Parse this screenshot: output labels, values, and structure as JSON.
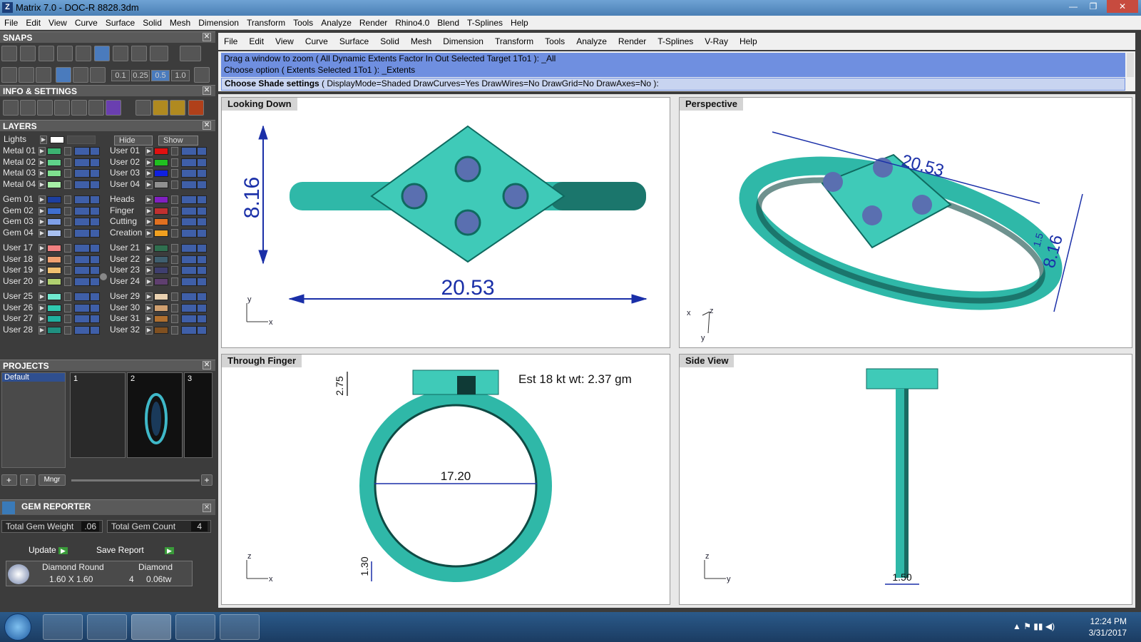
{
  "window": {
    "title": "Matrix 7.0 - DOC-R 8828.3dm",
    "icon": "Z"
  },
  "main_menu": [
    "File",
    "Edit",
    "View",
    "Curve",
    "Surface",
    "Solid",
    "Mesh",
    "Dimension",
    "Transform",
    "Tools",
    "Analyze",
    "Render",
    "Rhino4.0",
    "Blend",
    "T-Splines",
    "Help"
  ],
  "cmd_menu": [
    "File",
    "Edit",
    "View",
    "Curve",
    "Surface",
    "Solid",
    "Mesh",
    "Dimension",
    "Transform",
    "Tools",
    "Analyze",
    "Render",
    "T-Splines",
    "V-Ray",
    "Help"
  ],
  "command": {
    "line1": "Drag a window to zoom ( All  Dynamic  Extents  Factor  In  Out  Selected  Target  1To1 ): _All",
    "line2": "Choose option ( Extents  Selected  1To1 ): _Extents",
    "prompt_bold": "Choose Shade settings",
    "prompt_rest": " ( DisplayMode=Shaded  DrawCurves=Yes  DrawWires=No  DrawGrid=No  DrawAxes=No ):"
  },
  "panels": {
    "snaps": "SNAPS",
    "info": "INFO & SETTINGS",
    "layers": "LAYERS",
    "projects": "PROJECTS",
    "gem_reporter": "GEM REPORTER"
  },
  "snap_values": [
    "0.1",
    "0.25",
    "0.5",
    "1.0"
  ],
  "layers": {
    "lights": "Lights",
    "hide": "Hide",
    "show": "Show",
    "col1": [
      {
        "name": "Metal 01",
        "color": "#3cb371"
      },
      {
        "name": "Metal 02",
        "color": "#5fd38a"
      },
      {
        "name": "Metal 03",
        "color": "#7fe08f"
      },
      {
        "name": "Metal 04",
        "color": "#a6f0a6"
      },
      {
        "name": "Gem 01",
        "color": "#1d3fa0"
      },
      {
        "name": "Gem 02",
        "color": "#3f6fd0"
      },
      {
        "name": "Gem 03",
        "color": "#7fa0e8"
      },
      {
        "name": "Gem 04",
        "color": "#a8c0f0"
      },
      {
        "name": "User 17",
        "color": "#f08080"
      },
      {
        "name": "User 18",
        "color": "#f0a070"
      },
      {
        "name": "User 19",
        "color": "#f0c070"
      },
      {
        "name": "User 20",
        "color": "#b0d070"
      },
      {
        "name": "User 25",
        "color": "#70e8d0"
      },
      {
        "name": "User 26",
        "color": "#30c8b0"
      },
      {
        "name": "User 27",
        "color": "#20b0a0"
      },
      {
        "name": "User 28",
        "color": "#209080"
      }
    ],
    "col2": [
      {
        "name": "User 01",
        "color": "#e01010"
      },
      {
        "name": "User 02",
        "color": "#20c020"
      },
      {
        "name": "User 03",
        "color": "#1020e0"
      },
      {
        "name": "User 04",
        "color": "#909090"
      },
      {
        "name": "Heads",
        "color": "#8020c0"
      },
      {
        "name": "Finger",
        "color": "#c03030"
      },
      {
        "name": "Cutting",
        "color": "#e07020"
      },
      {
        "name": "Creation",
        "color": "#f0a020"
      },
      {
        "name": "User 21",
        "color": "#2f6f4f"
      },
      {
        "name": "User 22",
        "color": "#3f5f6f"
      },
      {
        "name": "User 23",
        "color": "#3f3f6f"
      },
      {
        "name": "User 24",
        "color": "#5f3f6f"
      },
      {
        "name": "User 29",
        "color": "#e8d0b0"
      },
      {
        "name": "User 30",
        "color": "#d0a070"
      },
      {
        "name": "User 31",
        "color": "#b07030"
      },
      {
        "name": "User 32",
        "color": "#805020"
      }
    ]
  },
  "projects": {
    "list": [
      "Default"
    ],
    "thumbs": [
      "1",
      "2",
      "3"
    ],
    "mngr": "Mngr"
  },
  "gem": {
    "weight_label": "Total Gem Weight",
    "weight_value": ".06",
    "count_label": "Total Gem Count",
    "count_value": "4",
    "update": "Update",
    "save": "Save Report",
    "row_type": "Diamond Round",
    "row_material": "Diamond",
    "row_size": "1.60 X 1.60",
    "row_qty": "4",
    "row_wt": "0.06tw"
  },
  "viewports": {
    "top_left": {
      "title": "Looking Down",
      "dim_h": "8.16",
      "dim_w": "20.53",
      "axis_a": "y",
      "axis_b": "x"
    },
    "top_right": {
      "title": "Perspective",
      "dim_a": "20.53",
      "dim_b": "8.16",
      "dim_c": "1.5",
      "axis_a": "x",
      "axis_b": "z",
      "axis_c": "y"
    },
    "bottom_left": {
      "title": "Through Finger",
      "dim_top": "2.75",
      "dim_inner": "17.20",
      "dim_bottom": "1.30",
      "note": "Est 18 kt wt: 2.37 gm",
      "axis_a": "z",
      "axis_b": "x"
    },
    "bottom_right": {
      "title": "Side View",
      "dim_w": "1.50",
      "axis_a": "z",
      "axis_b": "y"
    }
  },
  "clock": {
    "time": "12:24 PM",
    "date": "3/31/2017"
  },
  "colors": {
    "metal": "#2fb8a8",
    "gem": "#5a6fb0",
    "dimension": "#1a2fa8",
    "cmd_bg": "#6f8fe0"
  }
}
